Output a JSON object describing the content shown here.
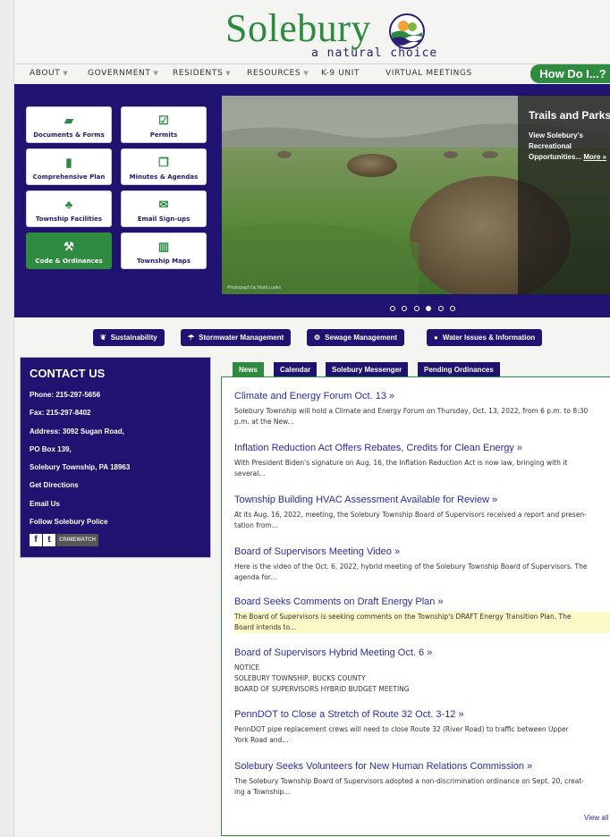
{
  "logo": {
    "word": "Solebury",
    "tagline": "a natural choice"
  },
  "nav": {
    "items": [
      {
        "label": "ABOUT",
        "caret": true
      },
      {
        "label": "GOVERNMENT",
        "caret": true
      },
      {
        "label": "RESIDENTS",
        "caret": true
      },
      {
        "label": "RESOURCES",
        "caret": true
      },
      {
        "label": "K-9 UNIT",
        "caret": false
      },
      {
        "label": "VIRTUAL MEETINGS",
        "caret": false
      }
    ],
    "how_do_i": "How Do I...?"
  },
  "quick_links": [
    {
      "label": "Documents & Forms",
      "icon": "folder-icon",
      "glyph": "▰"
    },
    {
      "label": "Permits",
      "icon": "checkbox-icon",
      "glyph": "☑"
    },
    {
      "label": "Comprehensive Plan",
      "icon": "book-icon",
      "glyph": "▮"
    },
    {
      "label": "Minutes & Agendas",
      "icon": "copy-icon",
      "glyph": "❐"
    },
    {
      "label": "Township Facilities",
      "icon": "tree-icon",
      "glyph": "♣"
    },
    {
      "label": "Email Sign-ups",
      "icon": "envelope-icon",
      "glyph": "✉"
    },
    {
      "label": "Code & Ordinances",
      "icon": "gavel-icon",
      "glyph": "⚒"
    },
    {
      "label": "Township Maps",
      "icon": "map-icon",
      "glyph": "▥"
    }
  ],
  "slide": {
    "title": "Trails and Parks",
    "body": "View Solebury's Recreational Opportunities...",
    "more": "More »",
    "credit": "Photograph by Mark Ludes",
    "dot_count": 6,
    "active_dot": 3
  },
  "pills": [
    {
      "label": "Sustainability",
      "icon": "leaf-icon",
      "glyph": "❦"
    },
    {
      "label": "Stormwater Management",
      "icon": "umbrella-icon",
      "glyph": "☂"
    },
    {
      "label": "Sewage Management",
      "icon": "gears-icon",
      "glyph": "⚙"
    },
    {
      "label": "Water Issues & Information",
      "icon": "drop-icon",
      "glyph": "●"
    }
  ],
  "contact": {
    "heading": "CONTACT US",
    "phone": "Phone: 215-297-5656",
    "fax": "Fax: 215-297-8402",
    "address1": "Address: 3092 Sugan Road,",
    "address2": "PO Box 139,",
    "address3": "Solebury Township, PA 18963",
    "directions": "Get Directions",
    "email": "Email Us",
    "follow": "Follow Solebury Police",
    "crimewatch": "CRIMEWATCH"
  },
  "tabs": [
    "News",
    "Calendar",
    "Solebury Messenger",
    "Pending Ordinances"
  ],
  "news": [
    {
      "title": "Climate and Energy Forum Oct. 13 »",
      "body": "Solebury Township will hold a Climate and Energy Forum on Thursday, Oct. 13, 2022, from 6 p.m. to 8:30\np.m. at the New..."
    },
    {
      "title": "Inflation Reduction Act Offers Rebates, Credits for Clean Energy »",
      "body": "With President Biden's signature on Aug. 16, the Inflation Reduction Act is now law, bringing with it\nseveral..."
    },
    {
      "title": "Township Building HVAC Assessment Available for Review »",
      "body": "At its Aug. 16, 2022, meeting, the Solebury Township Board of Supervisors received a report and presen-\ntation from..."
    },
    {
      "title": "Board of Supervisors Meeting Video »",
      "body": "Here is the video of the Oct. 6, 2022, hybrid meeting of the Solebury Township Board of Supervisors. The\nagenda for..."
    },
    {
      "title": "Board Seeks Comments on Draft Energy Plan »",
      "body": "The Board of Supervisors is seeking comments on the Township's DRAFT Energy Transition Plan. The\nBoard intends to..."
    },
    {
      "title": "Board of Supervisors Hybrid Meeting Oct. 6 »",
      "body": "NOTICE\nSOLEBURY TOWNSHIP, BUCKS COUNTY\nBOARD OF SUPERVISORS HYBRID BUDGET MEETING"
    },
    {
      "title": "PennDOT to Close a Stretch of Route 32 Oct. 3-12 »",
      "body": "PennDOT pipe replacement crews will need to close Route 32 (River Road) to traffic between Upper\nYork Road and..."
    },
    {
      "title": "Solebury Seeks Volunteers for New Human Relations Commission »",
      "body": "The Solebury Township Board of Supervisors adopted a non-discrimination ordinance on Sept. 20, creat-\ning a Township..."
    }
  ],
  "view_all": "View all"
}
